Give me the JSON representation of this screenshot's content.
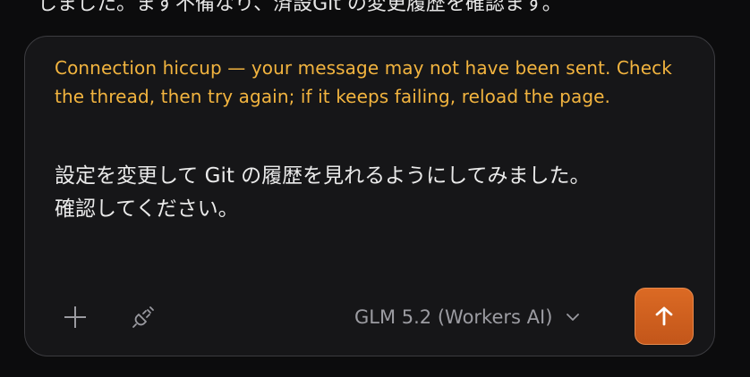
{
  "background": {
    "partial_text": "しました。まず不備なり、済設Git の変更履歴を確認ます。"
  },
  "composer": {
    "error_message": "Connection hiccup — your message may not have been sent. Check the thread, then try again; if it keeps failing, reload the page.",
    "input_value": "設定を変更して Git の履歴を見れるようにしてみました。\n確認してください。",
    "model_label": "GLM 5.2 (Workers AI)",
    "icons": {
      "add": "plus-icon",
      "tools": "plug-off-icon",
      "model_dropdown": "chevron-down-icon",
      "send": "arrow-up-icon"
    }
  },
  "colors": {
    "error_text": "#f2b43f",
    "send_button": "#d2601f",
    "composer_bg": "#161618",
    "composer_border": "#3c3c40"
  }
}
